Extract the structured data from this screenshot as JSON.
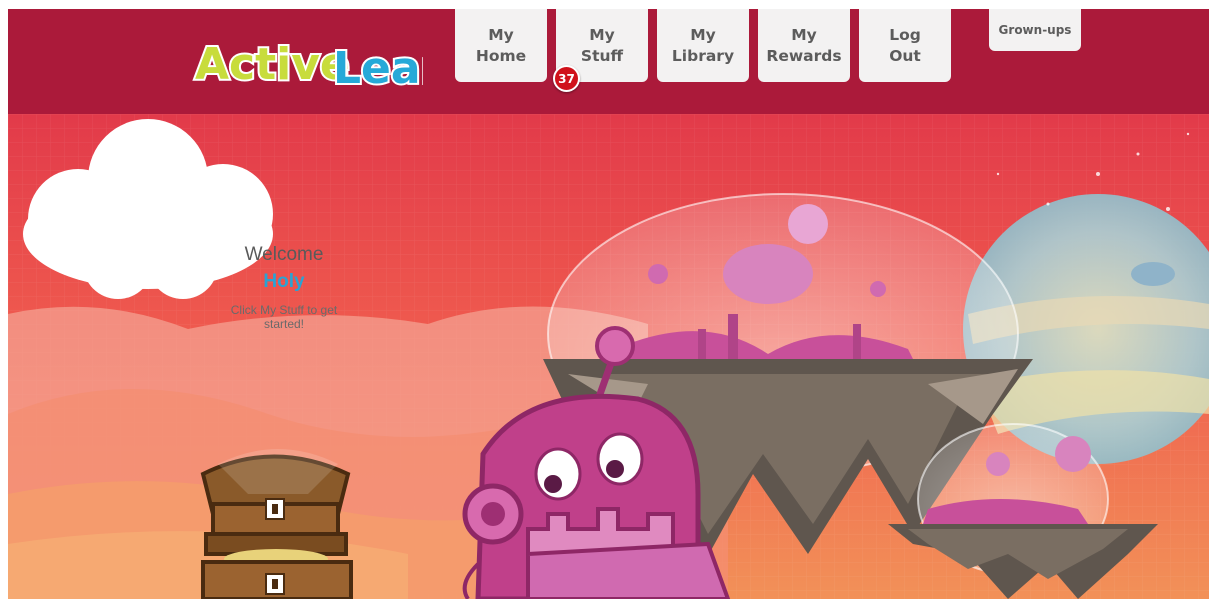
{
  "header": {
    "brand": {
      "word1": "Active",
      "word2": "Learn"
    },
    "nav": [
      {
        "line1": "My",
        "line2": "Home"
      },
      {
        "line1": "My",
        "line2": "Stuff",
        "badge": "37"
      },
      {
        "line1": "My",
        "line2": "Library"
      },
      {
        "line1": "My",
        "line2": "Rewards"
      },
      {
        "line1": "Log",
        "line2": "Out"
      }
    ],
    "grownups_label": "Grown-ups"
  },
  "welcome": {
    "title": "Welcome",
    "name": "Holy",
    "message": "Click My Stuff to get started!"
  },
  "colors": {
    "header_bg": "#ab1a3a",
    "sky_top": "#e23a4a",
    "sky_bottom": "#f29158",
    "nav_tab_bg": "#f3f2f2",
    "name_accent": "#2aa3d4",
    "badge": "#d0121b",
    "robot_pink": "#c0408a"
  },
  "icons": {
    "treasure": "treasure-chest-icon",
    "robot": "robot-character-icon",
    "floating_island": "floating-island-city-icon"
  }
}
